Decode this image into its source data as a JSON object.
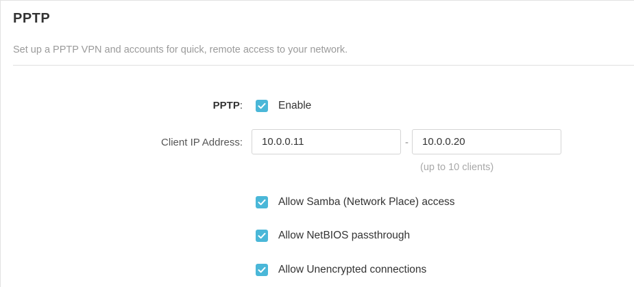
{
  "section": {
    "title": "PPTP",
    "description": "Set up a PPTP VPN and accounts for quick, remote access to your network."
  },
  "pptp": {
    "label": "PPTP",
    "colon": ":",
    "enable_label": "Enable",
    "enabled": true
  },
  "client_ip": {
    "label": "Client IP Address:",
    "start_value": "10.0.0.11",
    "separator": "-",
    "end_value": "10.0.0.20",
    "hint": "(up to 10 clients)"
  },
  "options": [
    {
      "label": "Allow Samba (Network Place) access",
      "checked": true
    },
    {
      "label": "Allow NetBIOS passthrough",
      "checked": true
    },
    {
      "label": "Allow Unencrypted connections",
      "checked": true
    }
  ],
  "colors": {
    "checkbox": "#4ab7d8",
    "hint": "#a8a8a8",
    "description": "#9a9a9a"
  }
}
